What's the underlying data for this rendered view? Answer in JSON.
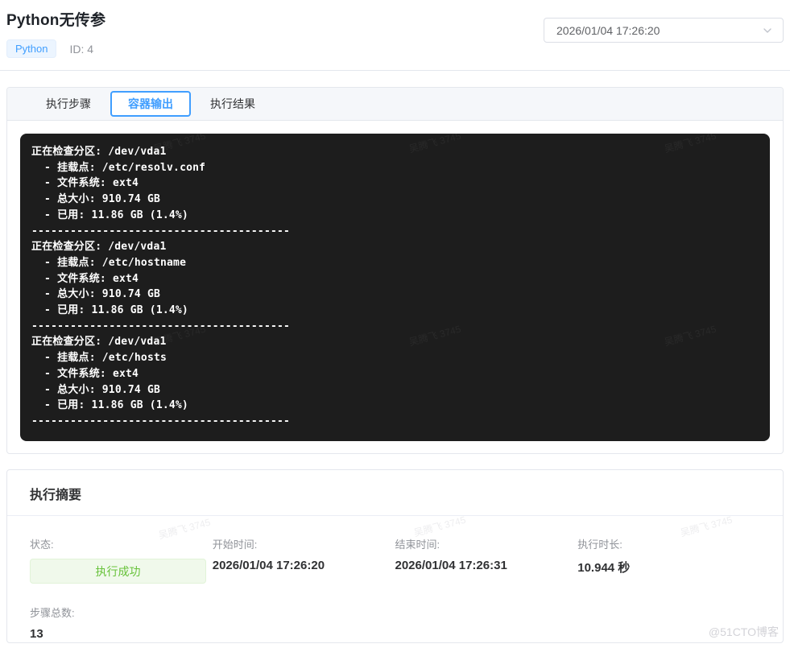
{
  "header": {
    "title": "Python无传参",
    "tag": "Python",
    "id_label": "ID: 4",
    "datetime_value": "2026/01/04 17:26:20"
  },
  "tabs": [
    {
      "label": "执行步骤",
      "active": false
    },
    {
      "label": "容器输出",
      "active": true
    },
    {
      "label": "执行结果",
      "active": false
    }
  ],
  "terminal": {
    "lines": [
      "正在检查分区: /dev/vda1",
      "  - 挂载点: /etc/resolv.conf",
      "  - 文件系统: ext4",
      "  - 总大小: 910.74 GB",
      "  - 已用: 11.86 GB (1.4%)",
      "----------------------------------------",
      "正在检查分区: /dev/vda1",
      "  - 挂载点: /etc/hostname",
      "  - 文件系统: ext4",
      "  - 总大小: 910.74 GB",
      "  - 已用: 11.86 GB (1.4%)",
      "----------------------------------------",
      "正在检查分区: /dev/vda1",
      "  - 挂载点: /etc/hosts",
      "  - 文件系统: ext4",
      "  - 总大小: 910.74 GB",
      "  - 已用: 11.86 GB (1.4%)",
      "----------------------------------------"
    ]
  },
  "summary": {
    "title": "执行摘要",
    "fields": [
      {
        "label": "状态:",
        "value": "执行成功"
      },
      {
        "label": "开始时间:",
        "value": "2026/01/04 17:26:20"
      },
      {
        "label": "结束时间:",
        "value": "2026/01/04 17:26:31"
      },
      {
        "label": "执行时长:",
        "value": "10.944 秒"
      },
      {
        "label": "步骤总数:",
        "value": "13"
      }
    ]
  },
  "watermark": {
    "text": "吴腾飞 3745",
    "site": "@51CTO博客"
  },
  "colors": {
    "accent_blue": "#409eff",
    "tag_bg": "#ecf5ff",
    "success_green": "#67c23a",
    "success_bg": "#f0f9eb",
    "terminal_bg": "#1d1d1d",
    "border": "#e4e7ed",
    "label_gray": "#909399"
  }
}
